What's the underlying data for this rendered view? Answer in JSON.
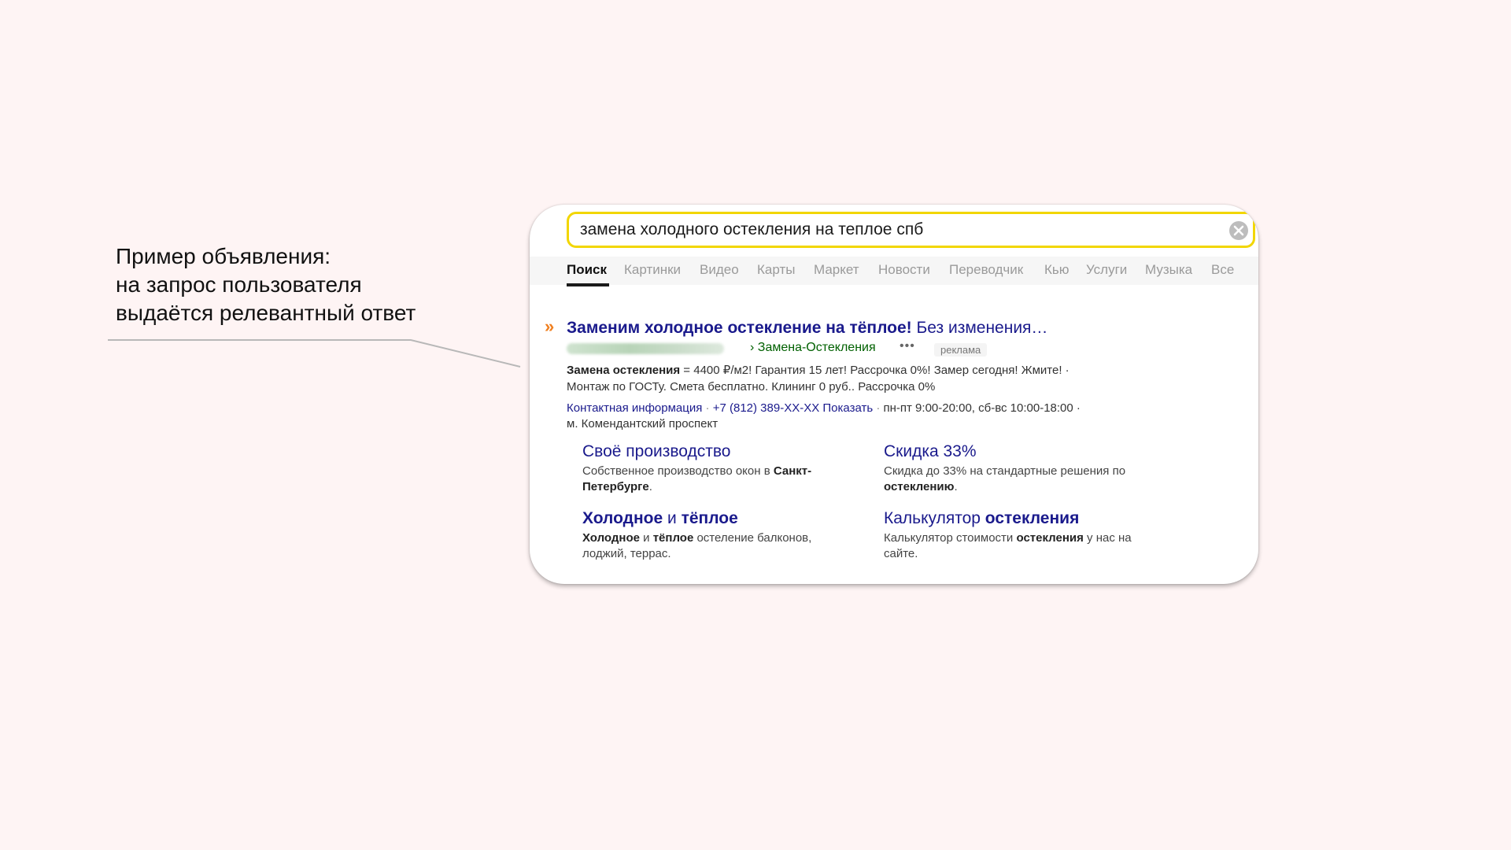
{
  "caption": {
    "line1": "Пример объявления:",
    "line2": "на запрос пользователя",
    "line3": "выдаётся релевантный ответ"
  },
  "search": {
    "value": "замена холодного остекления на теплое спб"
  },
  "tabs": [
    {
      "label": "Поиск",
      "active": true
    },
    {
      "label": "Картинки"
    },
    {
      "label": "Видео"
    },
    {
      "label": "Карты"
    },
    {
      "label": "Маркет"
    },
    {
      "label": "Новости"
    },
    {
      "label": "Переводчик"
    },
    {
      "label": "Кью"
    },
    {
      "label": "Услуги"
    },
    {
      "label": "Музыка"
    },
    {
      "label": "Все"
    }
  ],
  "ad": {
    "arrows": "»",
    "title_bold": "Заменим холодное остекление на тёплое!",
    "title_rest": " Без изменения…",
    "url_path": "› Замена-Остекления",
    "url_menu": "•••",
    "label": "реклама",
    "desc1_bold": "Замена остекления",
    "desc1_rest": " = 4400 ₽/м2! Гарантия 15 лет! Рассрочка 0%! Замер сегодня! Жмите! ·",
    "desc2": "Монтаж по ГОСТу. Смета бесплатно. Клининг 0 руб.. Рассрочка 0%",
    "contact_link": "Контактная информация",
    "sep": " · ",
    "phone": "+7 (812) 389-XX-XX Показать",
    "hours": "пн-пт 9:00-20:00, сб-вс 10:00-18:00 ·",
    "metro": "м. Комендантский проспект"
  },
  "sitelinks": [
    {
      "title_pre": "Своё производство",
      "title_bold": "",
      "title_post": "",
      "desc_pre": "Собственное производство окон в ",
      "desc_bold": "Санкт-Петербурге",
      "desc_post": "."
    },
    {
      "title_pre": "Скидка 33%",
      "title_bold": "",
      "title_post": "",
      "desc_pre": "Скидка до 33% на стандартные решения по ",
      "desc_bold": "остеклению",
      "desc_post": "."
    },
    {
      "title_pre": "",
      "title_bold": "Холодное",
      "title_mid": " и ",
      "title_bold2": "тёплое",
      "desc_b1": "Холодное",
      "desc_m1": " и ",
      "desc_b2": "тёплое",
      "desc_post": " остеление балконов, лоджий, террас."
    },
    {
      "title_pre": "Калькулятор ",
      "title_bold": "остекления",
      "title_post": "",
      "desc_pre": "Калькулятор стоимости ",
      "desc_bold": "остекления",
      "desc_post": " у нас на сайте."
    }
  ],
  "colors": {
    "background": "#fef4f4",
    "search_border": "#f2d600",
    "link": "#1a1a8c",
    "url": "#006000",
    "ad_arrows": "#f07f1f"
  }
}
